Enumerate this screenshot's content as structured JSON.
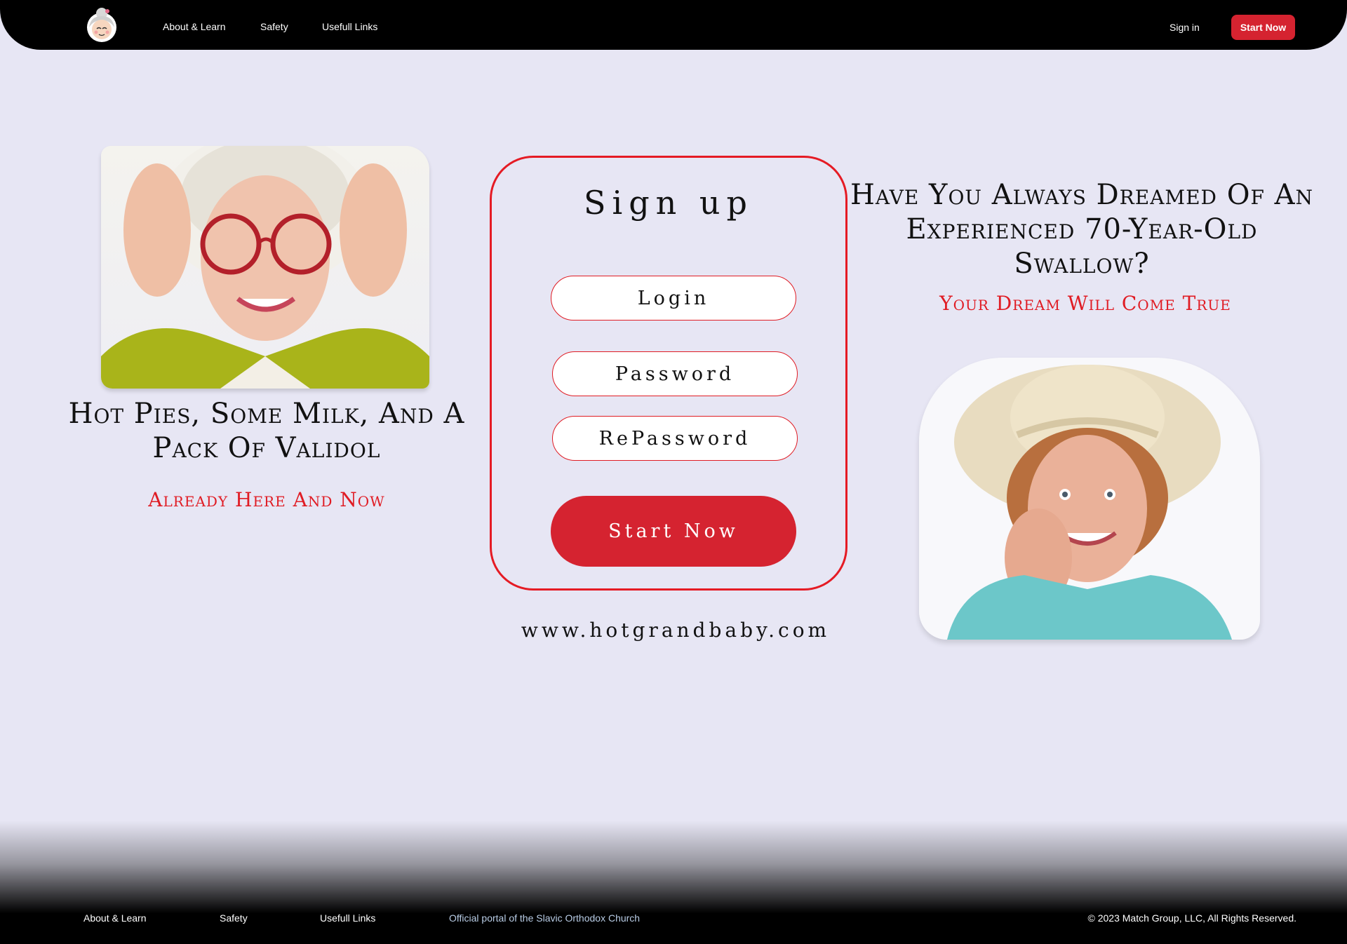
{
  "header": {
    "logo_icon": "grandma-avatar-logo",
    "nav": [
      {
        "label": "About & Learn"
      },
      {
        "label": "Safety"
      },
      {
        "label": "Usefull Links"
      }
    ],
    "sign_in": "Sign in",
    "start_now": "Start Now"
  },
  "left": {
    "photo": "elderly woman with red glasses photo",
    "headline": "Hot Pies, Some Milk, And A Pack Of Validol",
    "subline": "Already Here And Now"
  },
  "signup": {
    "title": "Sign up",
    "login_placeholder": "Login",
    "password_placeholder": "Password",
    "repassword_placeholder": "RePassword",
    "submit": "Start Now",
    "site_url": "www.hotgrandbaby.com"
  },
  "right": {
    "headline": "Have You Always Dreamed Of An Experienced 70-Year-Old Swallow?",
    "subline": "Your Dream Will Come True",
    "photo": "elderly woman with straw hat photo"
  },
  "footer": {
    "links": [
      {
        "label": "About & Learn"
      },
      {
        "label": "Safety"
      },
      {
        "label": "Usefull Links"
      },
      {
        "label": "Official portal of the Slavic Orthodox Church"
      }
    ],
    "copyright": "© 2023 Match Group, LLC, All Rights Reserved."
  },
  "colors": {
    "background": "#e7e6f4",
    "accent_red": "#d52330",
    "header_black": "#000000"
  }
}
